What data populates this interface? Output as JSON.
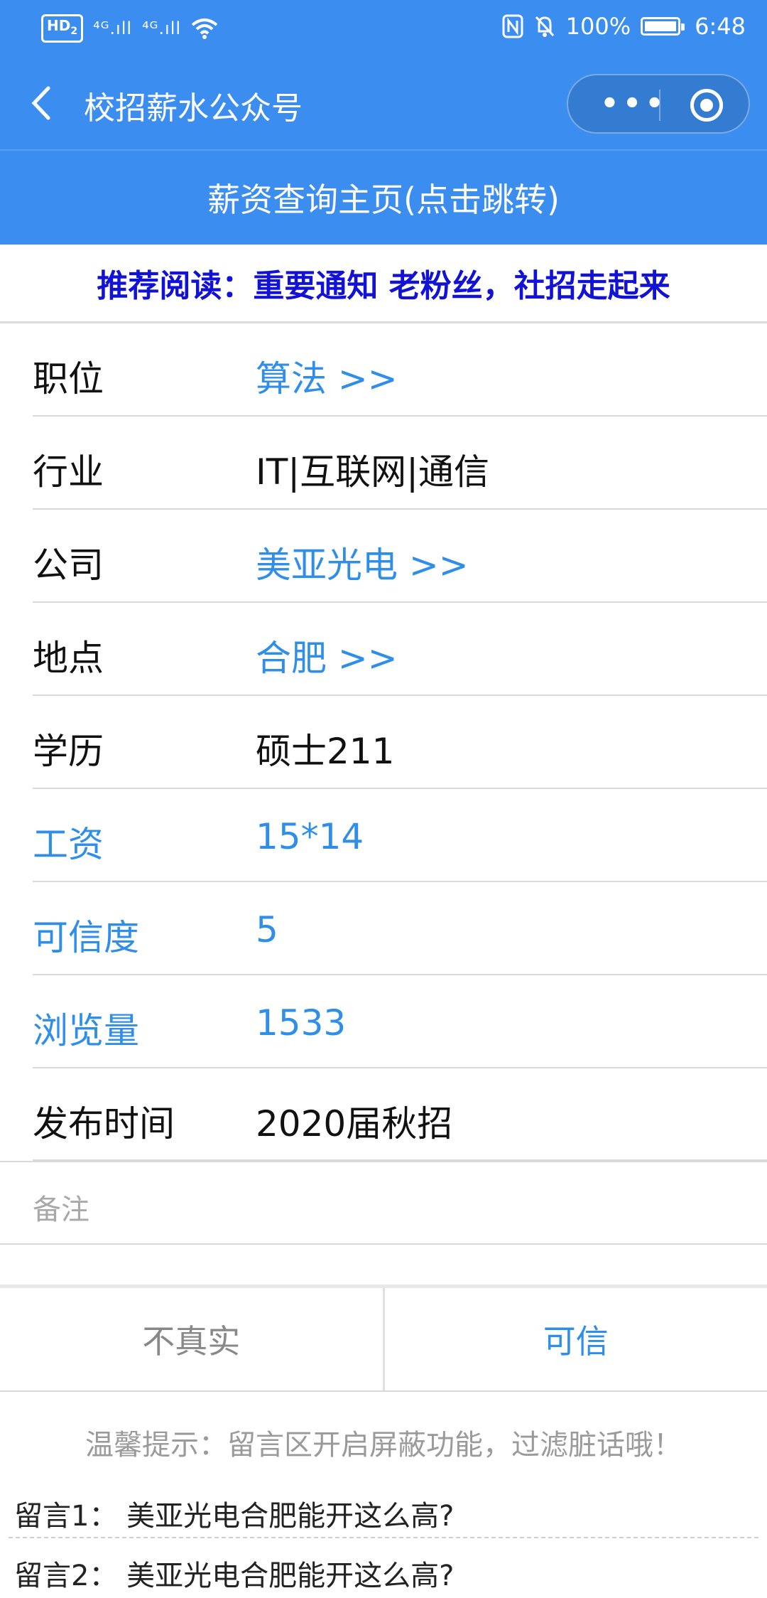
{
  "status_bar": {
    "hd_label": "HD",
    "hd_sub": "2",
    "signal1": "⁴ᴳ.ıll",
    "signal2": "⁴ᴳ.ıll",
    "battery_pct": "100%",
    "time": "6:48"
  },
  "nav": {
    "title": "校招薪水公众号",
    "more_label": "•••"
  },
  "banner": {
    "text": "薪资查询主页(点击跳转)"
  },
  "recommend": {
    "text": "推荐阅读：重要通知 老粉丝，社招走起来"
  },
  "fields": [
    {
      "label": "职位",
      "value": "算法 >>"
    },
    {
      "label": "行业",
      "value": "IT|互联网|通信"
    },
    {
      "label": "公司",
      "value": "美亚光电 >>"
    },
    {
      "label": "地点",
      "value": "合肥 >>"
    },
    {
      "label": "学历",
      "value": "硕士211"
    },
    {
      "label": "工资",
      "value": "15*14"
    },
    {
      "label": "可信度",
      "value": "5"
    },
    {
      "label": "浏览量",
      "value": "1533"
    },
    {
      "label": "发布时间",
      "value": "2020届秋招"
    }
  ],
  "note": {
    "label": "备注"
  },
  "buttons": {
    "fake": "不真实",
    "trust": "可信"
  },
  "tip": "温馨提示：留言区开启屏蔽功能，过滤脏话哦！",
  "comments": [
    "留言1：  美亚光电合肥能开这么高?",
    "留言2：  美亚光电合肥能开这么高?"
  ],
  "colors": {
    "primary": "#3b8ef0",
    "link": "#2f8ee8",
    "recommend": "#1212d6"
  }
}
